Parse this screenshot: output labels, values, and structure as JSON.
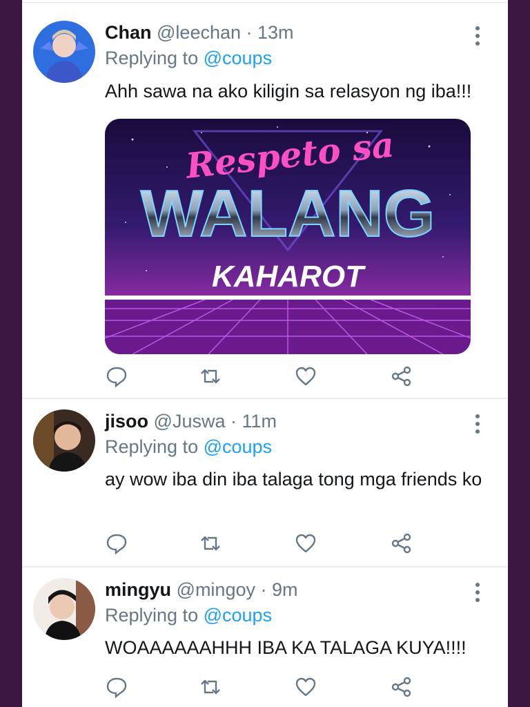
{
  "tweets": [
    {
      "name": "Chan",
      "handle": "@leechan",
      "time": "· 13m",
      "replying_prefix": "Replying to",
      "replying_to": "@coups",
      "text": "Ahh sawa na ako kiligin sa relasyon ng iba!!!",
      "media": {
        "line1": "Respeto sa",
        "line2": "WALANG",
        "line3": "KAHAROT"
      }
    },
    {
      "name": "jisoo",
      "handle": "@Juswa",
      "time": "· 11m",
      "replying_prefix": "Replying to",
      "replying_to": "@coups",
      "text": "ay wow iba din iba talaga tong mga friends ko"
    },
    {
      "name": "mingyu",
      "handle": "@mingoy",
      "time": "· 9m",
      "replying_prefix": "Replying to",
      "replying_to": "@coups",
      "text": "WOAAAAAAHHH IBA KA TALAGA KUYA!!!!"
    }
  ],
  "icons": {
    "reply": "reply-icon",
    "retweet": "retweet-icon",
    "like": "heart-icon",
    "share": "share-icon",
    "more": "more-vertical-icon"
  },
  "colors": {
    "background_frame": "#3a1640",
    "link": "#1da1f2",
    "secondary_text": "#657786",
    "primary_text": "#14171a"
  }
}
